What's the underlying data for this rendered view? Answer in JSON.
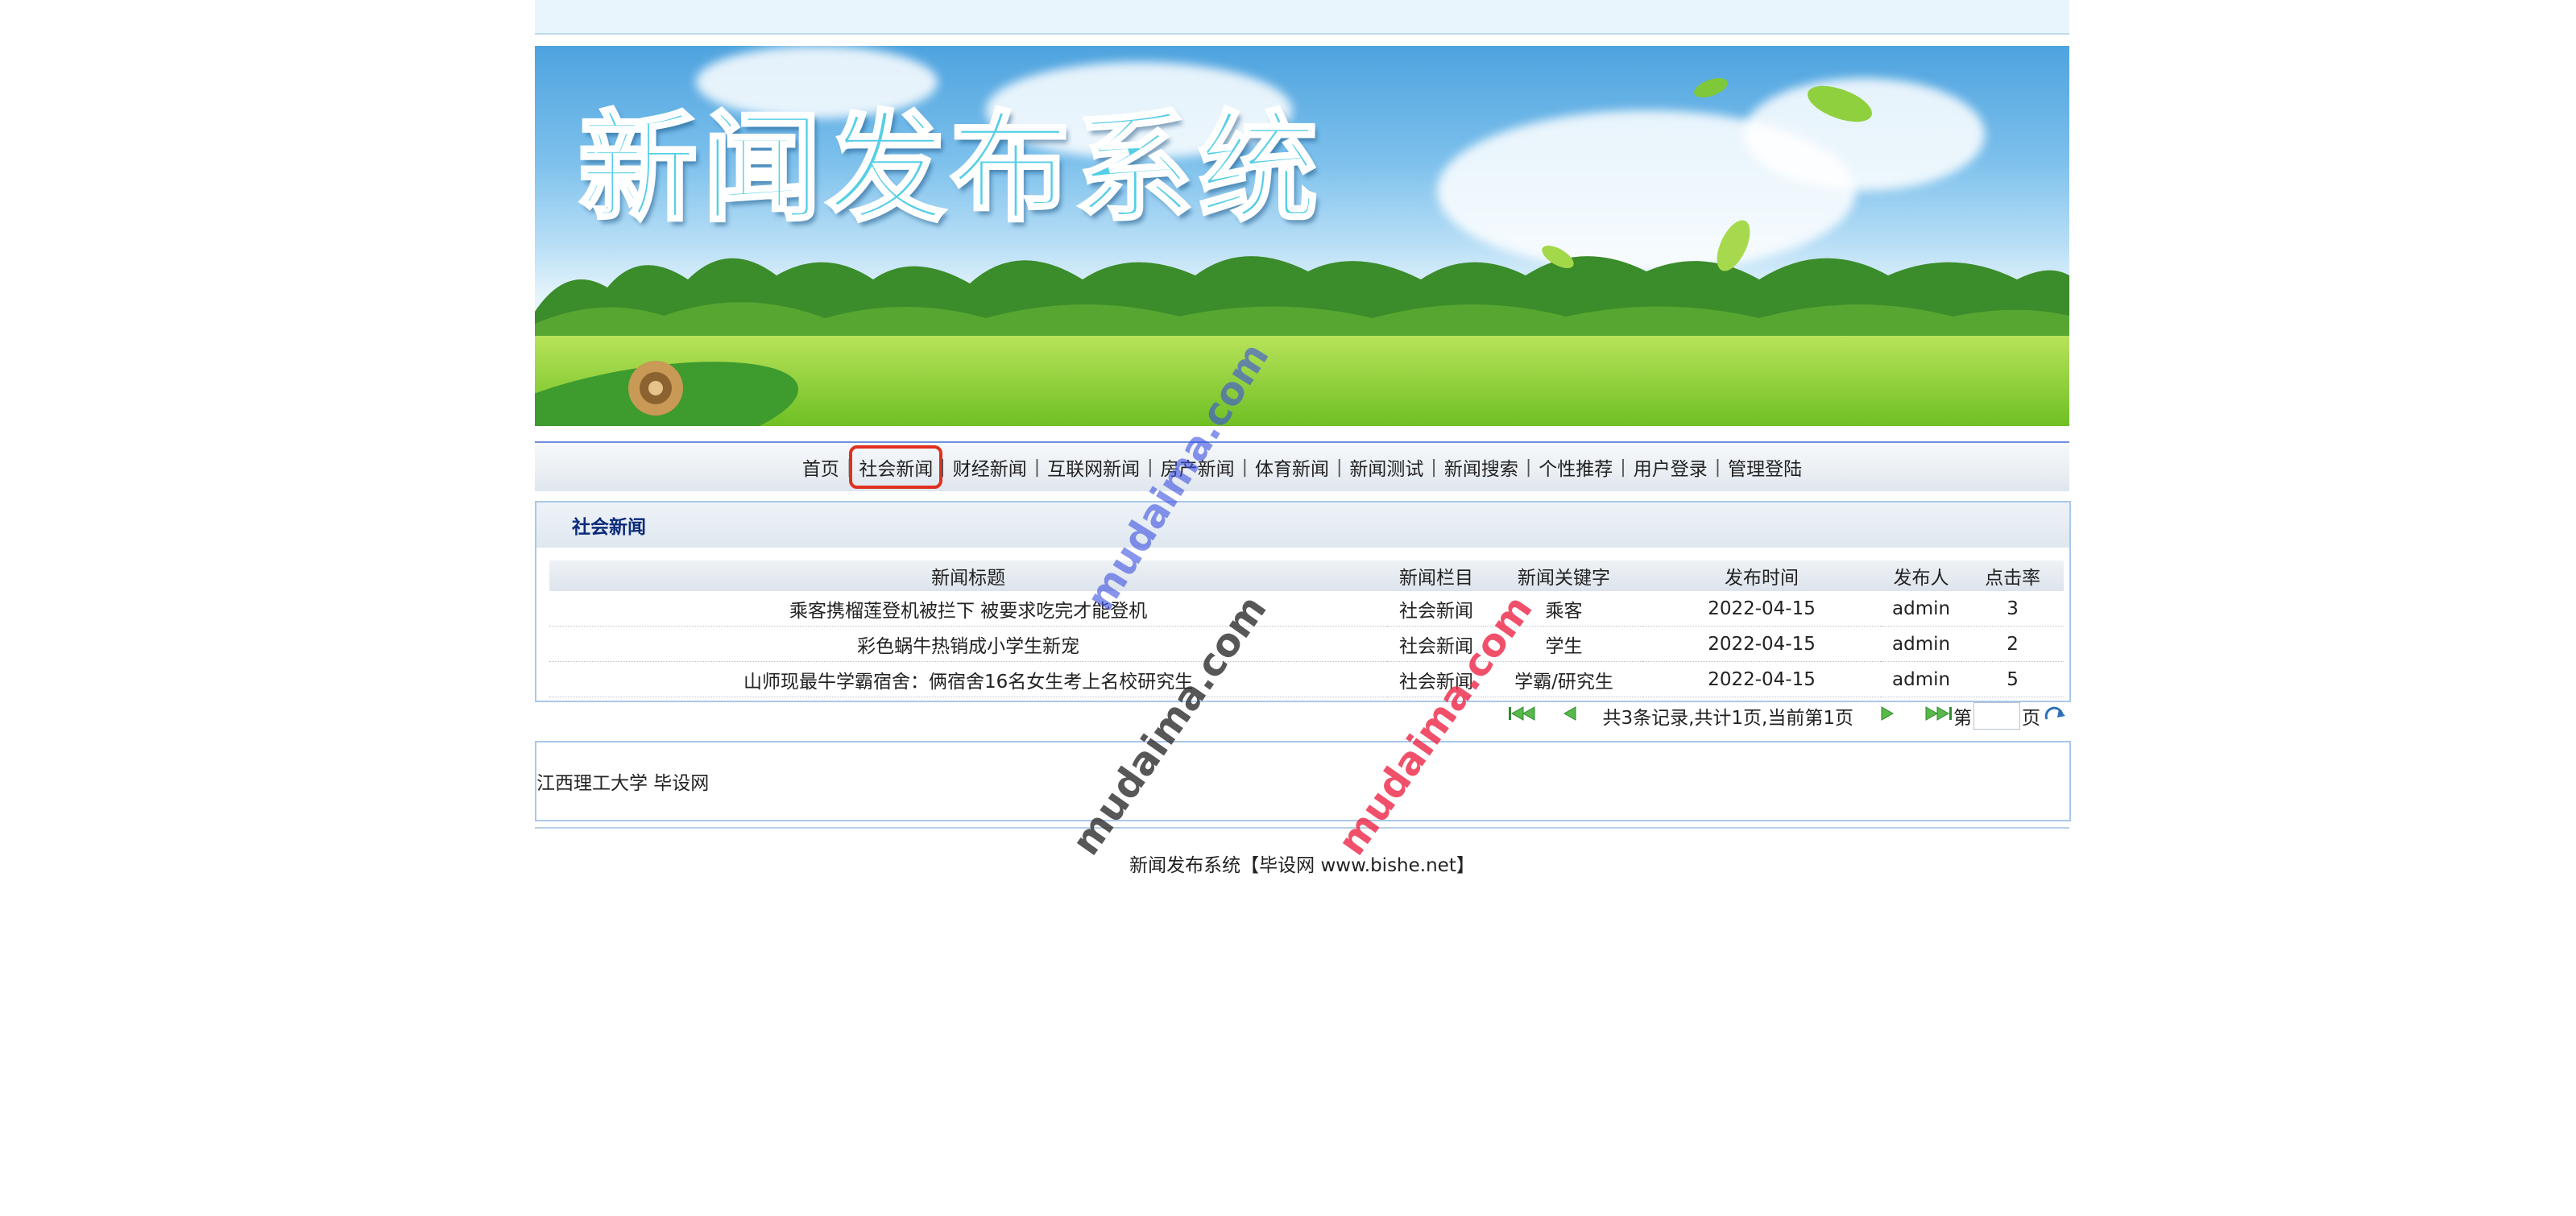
{
  "banner": {
    "title": "新闻发布系统"
  },
  "nav": {
    "items": [
      "首页",
      "社会新闻",
      "财经新闻",
      "互联网新闻",
      "房产新闻",
      "体育新闻",
      "新闻测试",
      "新闻搜索",
      "个性推荐",
      "用户登录",
      "管理登陆"
    ],
    "active_index": 1
  },
  "panel": {
    "title": "社会新闻",
    "columns": [
      "新闻标题",
      "新闻栏目",
      "新闻关键字",
      "发布时间",
      "发布人",
      "点击率"
    ],
    "rows": [
      [
        "乘客携榴莲登机被拦下 被要求吃完才能登机",
        "社会新闻",
        "乘客",
        "2022-04-15",
        "admin",
        "3"
      ],
      [
        "彩色蜗牛热销成小学生新宠",
        "社会新闻",
        "学生",
        "2022-04-15",
        "admin",
        "2"
      ],
      [
        "山师现最牛学霸宿舍：俩宿舍16名女生考上名校研究生",
        "社会新闻",
        "学霸/研究生",
        "2022-04-15",
        "admin",
        "5"
      ]
    ]
  },
  "pager": {
    "summary": "共3条记录,共计1页,当前第1页",
    "page_prefix": "第",
    "page_suffix": "页",
    "page_value": ""
  },
  "info": {
    "text": "江西理工大学 毕设网"
  },
  "footer": {
    "text": "新闻发布系统【毕设网 www.bishe.net】"
  },
  "watermarks": [
    "mudaima.com",
    "mudaima.com",
    "mudaima.com"
  ],
  "colors": {
    "nav_active_outline": "#e03020",
    "panel_title": "#0b2a7a",
    "border": "#a9c8ea"
  }
}
